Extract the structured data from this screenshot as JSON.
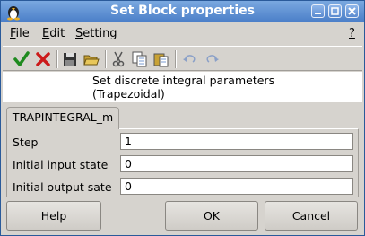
{
  "window": {
    "title": "Set Block properties",
    "title_bar_color": "#5b8bd0",
    "controls": [
      "minimize-icon",
      "maximize-icon",
      "close-icon"
    ]
  },
  "menubar": {
    "items": [
      {
        "label": "File",
        "mnemonic": "F",
        "rest": "ile"
      },
      {
        "label": "Edit",
        "mnemonic": "E",
        "rest": "dit"
      },
      {
        "label": "Setting",
        "mnemonic": "S",
        "rest": "etting"
      }
    ],
    "help": "?"
  },
  "toolbar": {
    "icons": [
      "ok-check-icon",
      "cancel-x-icon",
      "save-icon",
      "open-folder-icon",
      "cut-icon",
      "copy-icon",
      "paste-icon",
      "undo-icon",
      "redo-icon"
    ]
  },
  "description": {
    "line1": "Set discrete integral parameters",
    "line2": "(Trapezoidal)"
  },
  "tab": {
    "label": "TRAPINTEGRAL_m"
  },
  "fields": [
    {
      "label": "Step",
      "value": "1"
    },
    {
      "label": "Initial input state",
      "value": "0"
    },
    {
      "label": "Initial output sate",
      "value": "0"
    }
  ],
  "buttons": {
    "help": "Help",
    "ok": "OK",
    "cancel": "Cancel"
  }
}
